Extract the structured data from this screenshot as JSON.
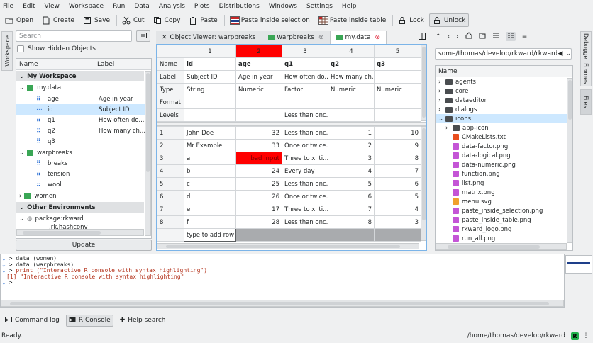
{
  "menu": [
    "File",
    "Edit",
    "View",
    "Workspace",
    "Run",
    "Data",
    "Analysis",
    "Plots",
    "Distributions",
    "Windows",
    "Settings",
    "Help"
  ],
  "toolbar": {
    "open": "Open",
    "create": "Create",
    "save": "Save",
    "cut": "Cut",
    "copy": "Copy",
    "paste": "Paste",
    "paste_inside_selection": "Paste inside selection",
    "paste_inside_table": "Paste inside table",
    "lock": "Lock",
    "unlock": "Unlock"
  },
  "left": {
    "side_tab": "Workspace",
    "search_placeholder": "Search",
    "show_hidden": "Show Hidden Objects",
    "col_name": "Name",
    "col_label": "Label",
    "my_workspace": "My Workspace",
    "rows": [
      {
        "name": "my.data",
        "label": ""
      },
      {
        "name": "age",
        "label": "Age in year"
      },
      {
        "name": "id",
        "label": "Subject ID"
      },
      {
        "name": "q1",
        "label": "How often do..."
      },
      {
        "name": "q2",
        "label": "How many ch..."
      },
      {
        "name": "q3",
        "label": ""
      },
      {
        "name": "warpbreaks",
        "label": ""
      },
      {
        "name": "breaks",
        "label": ""
      },
      {
        "name": "tension",
        "label": ""
      },
      {
        "name": "wool",
        "label": ""
      },
      {
        "name": "women",
        "label": ""
      }
    ],
    "other_env": "Other Environments",
    "package": "package:rkward",
    "partial": ".rk.hashconv",
    "update": "Update"
  },
  "center": {
    "tabs": [
      {
        "label": "Object Viewer: warpbreaks"
      },
      {
        "label": "warpbreaks"
      },
      {
        "label": "my.data"
      }
    ],
    "col_numbers": [
      "1",
      "2",
      "3",
      "4",
      "5"
    ],
    "meta_rows": [
      {
        "label": "Name",
        "cells": [
          "id",
          "age",
          "q1",
          "q2",
          "q3"
        ]
      },
      {
        "label": "Label",
        "cells": [
          "Subject ID",
          "Age in year",
          "How often do...",
          "How many ch...",
          ""
        ]
      },
      {
        "label": "Type",
        "cells": [
          "String",
          "Numeric",
          "Factor",
          "Numeric",
          "Numeric"
        ]
      },
      {
        "label": "Format",
        "cells": [
          "",
          "",
          "",
          "",
          ""
        ]
      },
      {
        "label": "Levels",
        "cells": [
          "",
          "",
          "Less than onc...",
          "",
          ""
        ]
      }
    ],
    "data_rows": [
      {
        "n": "1",
        "cells": [
          "John Doe",
          "32",
          "Less than onc...",
          "1",
          "10"
        ]
      },
      {
        "n": "2",
        "cells": [
          "Mr Example",
          "33",
          "Once or twice...",
          "2",
          "9"
        ]
      },
      {
        "n": "3",
        "cells": [
          "a",
          "bad input",
          "Three to xi ti...",
          "3",
          "8"
        ]
      },
      {
        "n": "4",
        "cells": [
          "b",
          "24",
          "Every day",
          "4",
          "7"
        ]
      },
      {
        "n": "5",
        "cells": [
          "c",
          "25",
          "Less than onc...",
          "5",
          "6"
        ]
      },
      {
        "n": "6",
        "cells": [
          "d",
          "26",
          "Once or twice...",
          "6",
          "5"
        ]
      },
      {
        "n": "7",
        "cells": [
          "e",
          "17",
          "Three to xi ti...",
          "7",
          "4"
        ]
      },
      {
        "n": "8",
        "cells": [
          "f",
          "28",
          "Less than onc...",
          "8",
          "3"
        ]
      }
    ],
    "add_row": "type to add row"
  },
  "right": {
    "path": "some/thomas/develop/rkward/rkward/",
    "col_name": "Name",
    "items": [
      {
        "name": "agents",
        "kind": "folder"
      },
      {
        "name": "core",
        "kind": "folder"
      },
      {
        "name": "dataeditor",
        "kind": "folder"
      },
      {
        "name": "dialogs",
        "kind": "folder"
      },
      {
        "name": "icons",
        "kind": "folder-open"
      },
      {
        "name": "app-icon",
        "kind": "folder"
      },
      {
        "name": "CMakeLists.txt",
        "kind": "cmake"
      },
      {
        "name": "data-factor.png",
        "kind": "png"
      },
      {
        "name": "data-logical.png",
        "kind": "png"
      },
      {
        "name": "data-numeric.png",
        "kind": "png"
      },
      {
        "name": "function.png",
        "kind": "png"
      },
      {
        "name": "list.png",
        "kind": "png"
      },
      {
        "name": "matrix.png",
        "kind": "png"
      },
      {
        "name": "menu.svg",
        "kind": "svg"
      },
      {
        "name": "paste_inside_selection.png",
        "kind": "png"
      },
      {
        "name": "paste_inside_table.png",
        "kind": "png"
      },
      {
        "name": "rkward_logo.png",
        "kind": "png"
      },
      {
        "name": "run_all.png",
        "kind": "png"
      }
    ],
    "side_tabs": [
      "Debugger Frames",
      "Files"
    ]
  },
  "console": {
    "lines": [
      {
        "prompt": ">",
        "code": "data (women)"
      },
      {
        "prompt": ">",
        "code": "data (warpbreaks)"
      },
      {
        "prompt": ">",
        "code": "print (\"Interactive R console with syntax highlighting\")"
      },
      {
        "prompt": "",
        "code": "[1] \"Interactive R console with syntax highlighting\""
      },
      {
        "prompt": ">",
        "code": ""
      }
    ]
  },
  "bottom_tabs": [
    "Command log",
    "R Console",
    "Help search"
  ],
  "status": {
    "left": "Ready.",
    "path": "/home/thomas/develop/rkward",
    "r_badge": "R"
  },
  "colors": {
    "highlight": "#ff0000",
    "selection": "#cde8ff"
  }
}
